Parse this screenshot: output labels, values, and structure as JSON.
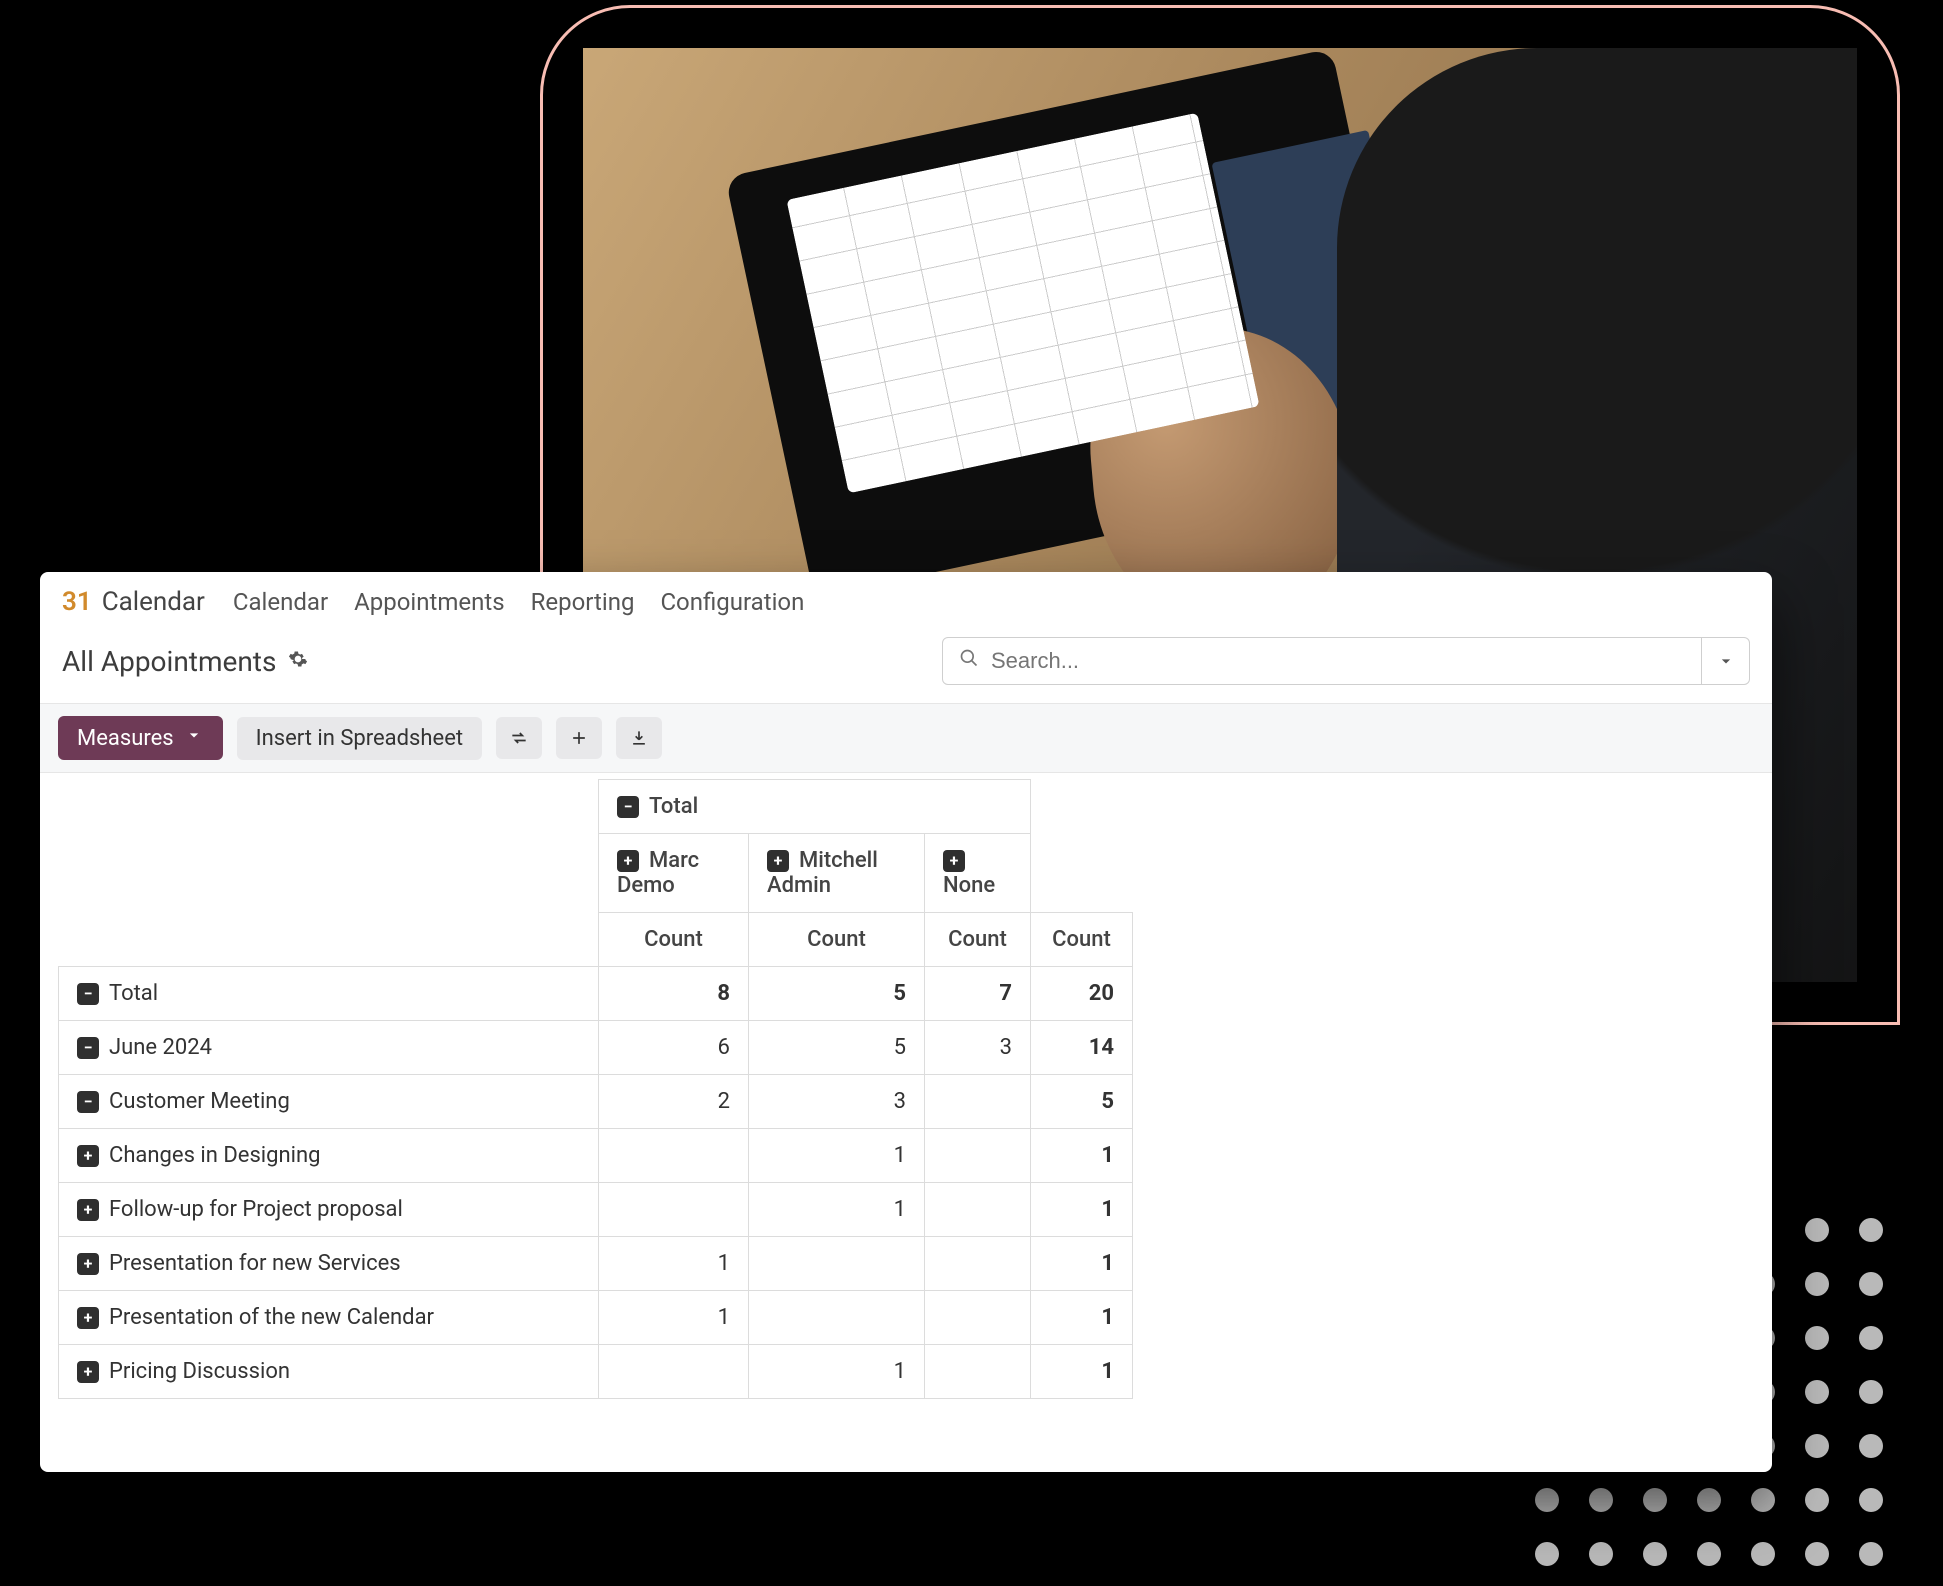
{
  "brand": {
    "icon_text": "31",
    "name": "Calendar"
  },
  "menu": {
    "calendar": "Calendar",
    "appointments": "Appointments",
    "reporting": "Reporting",
    "configuration": "Configuration"
  },
  "page": {
    "title": "All Appointments"
  },
  "search": {
    "placeholder": "Search..."
  },
  "toolbar": {
    "measures": "Measures",
    "insert_spreadsheet": "Insert in Spreadsheet"
  },
  "pivot": {
    "total_label": "Total",
    "col_groups": [
      "Marc Demo",
      "Mitchell Admin",
      "None"
    ],
    "count_label": "Count",
    "rows": [
      {
        "label": "Total",
        "depth": 0,
        "expand": "minus",
        "vals": [
          "8",
          "5",
          "7",
          "20"
        ],
        "bold_last": true
      },
      {
        "label": "June 2024",
        "depth": 1,
        "expand": "minus",
        "vals": [
          "6",
          "5",
          "3",
          "14"
        ],
        "bold_last": true
      },
      {
        "label": "Customer Meeting",
        "depth": 2,
        "expand": "minus",
        "vals": [
          "2",
          "3",
          "",
          "5"
        ],
        "bold_last": true
      },
      {
        "label": "Changes in Designing",
        "depth": 3,
        "expand": "plus",
        "vals": [
          "",
          "1",
          "",
          "1"
        ],
        "bold_last": true
      },
      {
        "label": "Follow-up for Project proposal",
        "depth": 3,
        "expand": "plus",
        "vals": [
          "",
          "1",
          "",
          "1"
        ],
        "bold_last": true
      },
      {
        "label": "Presentation for new Services",
        "depth": 3,
        "expand": "plus",
        "vals": [
          "1",
          "",
          "",
          "1"
        ],
        "bold_last": true
      },
      {
        "label": "Presentation of the new Calendar",
        "depth": 3,
        "expand": "plus",
        "vals": [
          "1",
          "",
          "",
          "1"
        ],
        "bold_last": true
      },
      {
        "label": "Pricing Discussion",
        "depth": 3,
        "expand": "plus",
        "vals": [
          "",
          "1",
          "",
          "1"
        ],
        "bold_last": true
      }
    ]
  }
}
